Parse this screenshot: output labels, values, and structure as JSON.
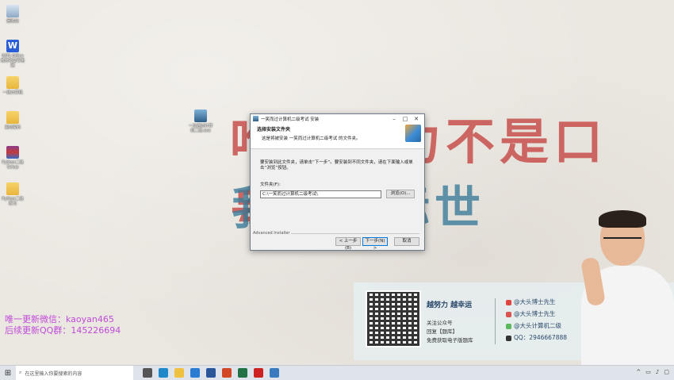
{
  "desktop": {
    "icons": [
      {
        "label": "回收站",
        "icon": "recycle-bin-icon"
      },
      {
        "label": "WPS Office 教育考试专用版",
        "icon": "wps-icon"
      },
      {
        "label": "一级计算机",
        "icon": "folder-icon"
      },
      {
        "label": "素材资料",
        "icon": "folder-icon"
      },
      {
        "label": "Python二级 Setup",
        "icon": "winrar-icon"
      },
      {
        "label": "Python二级 练习",
        "icon": "folder-icon"
      }
    ],
    "center_icon": {
      "label": "一次通过计算机二级.exe",
      "icon": "installer-icon"
    },
    "wallpaper_line1": "唯有努力不是口号，做",
    "wallpaper_line2": "我的目标世"
  },
  "dialog": {
    "title": "一笑而过计算机二级考试 安装",
    "header_title": "选择安装文件夹",
    "header_subtitle": "这是将被安装 一笑而过计算机二级考试 的文件夹。",
    "instruction": "要安装到此文件夹，请单击“下一步”。要安装到不同文件夹，请在下面输入或单击“浏览”按钮。",
    "folder_label": "文件夹(F):",
    "folder_path": "C:\\一笑而过计算机二级考试\\",
    "browse": "浏览(O)...",
    "brand": "Advanced Installer",
    "back": "< 上一步(B)",
    "next": "下一步(N) >",
    "cancel": "取消"
  },
  "promo": {
    "wechat": "唯一更新微信：kaoyan465",
    "qq": "后续更新QQ群：145226694"
  },
  "qr_panel": {
    "slogan": "越努力 越幸运",
    "follow": "关注公众号",
    "reply": "回复【题库】",
    "free": "免费获取电子版题库",
    "social": [
      {
        "label": "@大头博士先生",
        "icon": "weibo-icon",
        "color": "#e0443e"
      },
      {
        "label": "@大头博士先生",
        "icon": "mail-icon",
        "color": "#d9534f"
      },
      {
        "label": "@大头计算机二级",
        "icon": "wechat-icon",
        "color": "#5cb85c"
      },
      {
        "label": "QQ：2946667888",
        "icon": "qq-icon",
        "color": "#333333"
      }
    ]
  },
  "taskbar": {
    "search_placeholder": "在这里输入你要搜索的内容",
    "apps": [
      "task-view-icon",
      "edge-icon",
      "file-explorer-icon",
      "mail-icon",
      "word-icon",
      "powerpoint-icon",
      "excel-icon",
      "recorder-icon",
      "installer-icon"
    ],
    "app_colors": [
      "#555555",
      "#1e88c8",
      "#f0c040",
      "#2b7cd3",
      "#2b579a",
      "#d24726",
      "#217346",
      "#cc2222",
      "#3a7bbf"
    ]
  }
}
